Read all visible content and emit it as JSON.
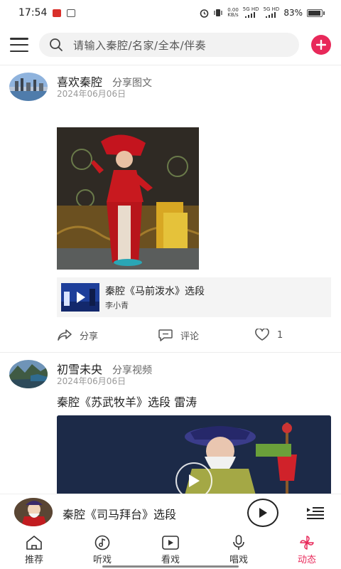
{
  "status_bar": {
    "time": "17:54",
    "net_speed_top": "0.00",
    "net_speed_bottom": "KB/s",
    "signal1": "5G HD",
    "signal2": "5G HD",
    "battery_text": "83%",
    "battery_level": 0.83
  },
  "top_bar": {
    "search_placeholder": "请输入秦腔/名家/全本/伴奏"
  },
  "posts": [
    {
      "user": "喜欢秦腔",
      "share_type": "分享图文",
      "date": "2024年06月06日",
      "linked": {
        "title": "秦腔《马前泼水》选段",
        "author": "李小青"
      },
      "actions": {
        "share_label": "分享",
        "comment_label": "评论",
        "like_count": "1"
      }
    },
    {
      "user": "初雪未央",
      "share_type": "分享视频",
      "date": "2024年06月06日",
      "title": "秦腔《苏武牧羊》选段 雷涛"
    }
  ],
  "player": {
    "title": "秦腔《司马拜台》选段"
  },
  "nav": [
    {
      "label": "推荐",
      "icon": "home-icon",
      "active": false
    },
    {
      "label": "听戏",
      "icon": "music-note-icon",
      "active": false
    },
    {
      "label": "看戏",
      "icon": "video-play-icon",
      "active": false
    },
    {
      "label": "唱戏",
      "icon": "microphone-icon",
      "active": false
    },
    {
      "label": "动态",
      "icon": "pinwheel-icon",
      "active": true
    }
  ],
  "colors": {
    "accent": "#e8295a",
    "text": "#222222",
    "muted": "#999999"
  }
}
